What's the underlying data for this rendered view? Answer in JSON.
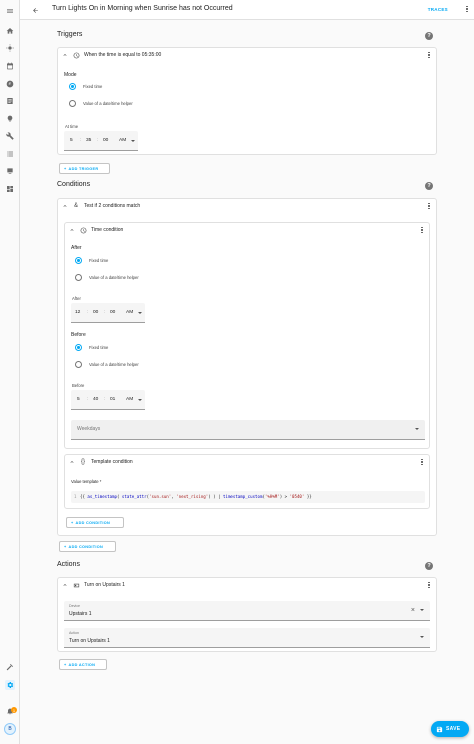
{
  "header": {
    "title": "Turn Lights On in Morning when Sunrise has not Occurred",
    "traces_label": "TRACES"
  },
  "triggers": {
    "section_title": "Triggers",
    "card_title": "When the time is equal to 05:35:00",
    "mode_label": "Mode",
    "option_fixed": "Fixed time",
    "option_helper": "Value of a date/time helper",
    "at_label": "At time",
    "time": {
      "h": "5",
      "m": "35",
      "s": "00",
      "ampm": "AM"
    },
    "add_button": "ADD TRIGGER"
  },
  "conditions": {
    "section_title": "Conditions",
    "and_card_title": "Test if 2 conditions match",
    "time_card_title": "Time condition",
    "after_section": "After",
    "option_fixed": "Fixed time",
    "option_helper": "Value of a date/time helper",
    "after_label": "After",
    "after_time": {
      "h": "12",
      "m": "00",
      "s": "00",
      "ampm": "AM"
    },
    "before_section": "Before",
    "before_label": "Before",
    "before_time": {
      "h": "5",
      "m": "40",
      "s": "01",
      "ampm": "AM"
    },
    "weekdays_placeholder": "Weekdays",
    "template_card_title": "Template condition",
    "value_template_label": "Value template *",
    "code_line_number": "1",
    "code_parts": {
      "p1": "{{ ",
      "p2": "as_timestamp",
      "p3": "( ",
      "p4": "state_attr",
      "p5": "(",
      "p6": "'sun.sun'",
      "p7": ", ",
      "p8": "'next_rising'",
      "p9": ") ) | ",
      "p10": "timestamp_custom",
      "p11": "(",
      "p12": "'%H%M'",
      "p13": ") > ",
      "p14": "'0540'",
      "p15": " }}"
    },
    "inner_add_button": "ADD CONDITION",
    "add_button": "ADD CONDITION"
  },
  "actions": {
    "section_title": "Actions",
    "card_title": "Turn on Upstairs 1",
    "device_label": "Device",
    "device_value": "Upstairs 1",
    "action_label": "Action",
    "action_value": "Turn on Upstairs 1",
    "add_button": "ADD ACTION"
  },
  "save_label": "SAVE",
  "sidebar": {
    "avatar_initial": "B",
    "notification_count": "1"
  },
  "colors": {
    "accent": "#03a9f4",
    "code_string": "#a31515",
    "code_func": "#0000c0"
  }
}
